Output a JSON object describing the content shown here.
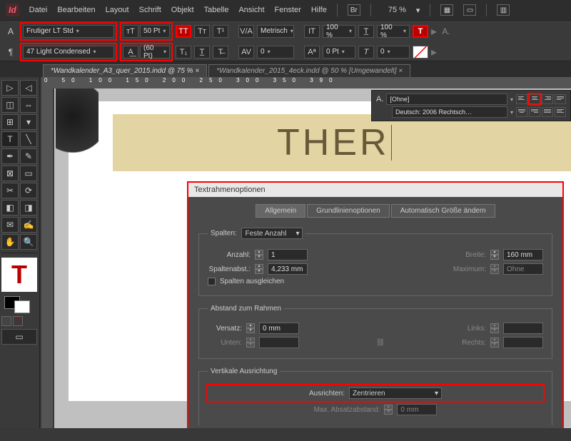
{
  "menu": {
    "items": [
      "Datei",
      "Bearbeiten",
      "Layout",
      "Schrift",
      "Objekt",
      "Tabelle",
      "Ansicht",
      "Fenster",
      "Hilfe"
    ],
    "br": "Br",
    "zoom": "75 %"
  },
  "ctrl": {
    "font_family": "Frutiger LT Std",
    "font_weight": "47 Light Condensed",
    "size": "50 Pt",
    "leading": "(60 Pt)",
    "kerning": "Metrisch",
    "tracking": "0",
    "hscale": "100 %",
    "vscale": "100 %",
    "baseline": "0 Pt",
    "skew": "0"
  },
  "tabs": [
    {
      "label": "*Wandkalender_A3_quer_2015.indd @ 75 %",
      "active": true
    },
    {
      "label": "*Wandkalender_2015_4eck.indd @ 50 % [Umgewandelt]",
      "active": false
    }
  ],
  "ruler_marks": "0     50    100    150    200    250    300    350    390",
  "canvas_text": "THER",
  "para_panel": {
    "A": "A.",
    "style": "[Ohne]",
    "lang": "Deutsch: 2006 Rechtsch…"
  },
  "dialog": {
    "title": "Textrahmenoptionen",
    "tabs": [
      "Allgemein",
      "Grundlinienoptionen",
      "Automatisch Größe ändern"
    ],
    "spalten": {
      "legend": "Spalten:",
      "type": "Feste Anzahl",
      "anzahl_lbl": "Anzahl:",
      "anzahl": "1",
      "breite_lbl": "Breite:",
      "breite": "160 mm",
      "abst_lbl": "Spaltenabst.:",
      "abst": "4,233 mm",
      "max_lbl": "Maximum:",
      "max": "Ohne",
      "ausgleichen": "Spalten ausgleichen"
    },
    "abstand": {
      "legend": "Abstand zum Rahmen",
      "versatz_lbl": "Versatz:",
      "versatz": "0 mm",
      "links_lbl": "Links:",
      "unten_lbl": "Unten:",
      "rechts_lbl": "Rechts:"
    },
    "vert": {
      "legend": "Vertikale Ausrichtung",
      "ausrichten_lbl": "Ausrichten:",
      "ausrichten": "Zentrieren",
      "max_abs_lbl": "Max. Absatzabstand:",
      "max_abs": "0 mm"
    }
  }
}
